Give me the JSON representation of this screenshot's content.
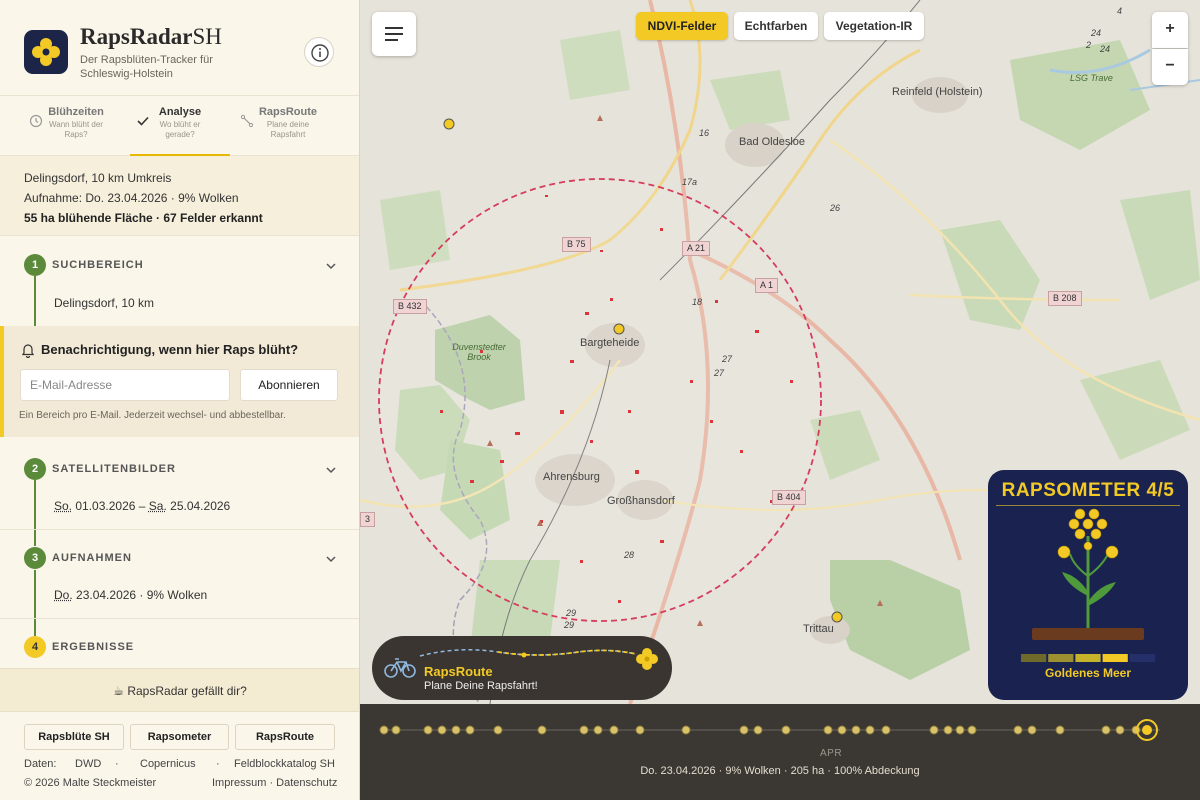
{
  "app": {
    "title_bold": "RapsRadar",
    "title_light": "SH",
    "subtitle": "Der Rapsblüten-Tracker für Schleswig-Holstein"
  },
  "tabs": [
    {
      "label": "Blühzeiten",
      "sub": "Wann blüht der Raps?",
      "icon": "clock-icon",
      "active": false
    },
    {
      "label": "Analyse",
      "sub": "Wo blüht er gerade?",
      "icon": "check-icon",
      "active": true
    },
    {
      "label": "RapsRoute",
      "sub": "Plane deine Rapsfahrt",
      "icon": "route-icon",
      "active": false
    }
  ],
  "summary": {
    "line1": "Delingsdorf, 10 km Umkreis",
    "line2": "Aufnahme: Do. 23.04.2026 · 9% Wolken",
    "line3": "55 ha blühende Fläche · 67 Felder erkannt"
  },
  "steps": [
    {
      "num": "1",
      "title": "SUCHBEREICH",
      "value": "Delingsdorf, 10 km"
    },
    {
      "num": "2",
      "title": "SATELLITENBILDER",
      "value_from": "So.",
      "date_from": "01.03.2026",
      "sep": "–",
      "value_to": "Sa.",
      "date_to": "25.04.2026"
    },
    {
      "num": "3",
      "title": "AUFNAHMEN",
      "value_day": "Do.",
      "value": "23.04.2026 · 9% Wolken"
    },
    {
      "num": "4",
      "title": "ERGEBNISSE"
    }
  ],
  "notify": {
    "title": "Benachrichtigung, wenn hier Raps blüht?",
    "placeholder": "E-Mail-Adresse",
    "button": "Abonnieren",
    "note": "Ein Bereich pro E-Mail. Jederzeit wechsel- und abbestellbar."
  },
  "like": "☕  RapsRadar gefällt dir?",
  "footer": {
    "buttons": [
      "Rapsblüte SH",
      "Rapsometer",
      "RapsRoute"
    ],
    "data_label": "Daten:",
    "sources": [
      "DWD",
      "·",
      "Copernicus",
      "·",
      "Feldblockkatalog SH"
    ],
    "copyright": "© 2026 Malte Steckmeister",
    "links": "Impressum · Datenschutz"
  },
  "map": {
    "layers": [
      {
        "label": "NDVI-Felder",
        "active": true
      },
      {
        "label": "Echtfarben",
        "active": false
      },
      {
        "label": "Vegetation-IR",
        "active": false
      }
    ],
    "zoom_in": "+",
    "zoom_out": "−",
    "places": [
      "Reinfeld (Holstein)",
      "Bad Oldesloe",
      "Bargteheide",
      "Ahrensburg",
      "Großhansdorf",
      "Trittau",
      "Duvenstedter Brook",
      "LSG Trave"
    ],
    "roads": [
      "B 75",
      "A 21",
      "A 1",
      "B 432",
      "B 208",
      "B 404",
      "3"
    ],
    "road_numbers": [
      "16",
      "17a",
      "26",
      "18",
      "27",
      "27",
      "28",
      "29",
      "29",
      "24",
      "24",
      "2",
      "4"
    ]
  },
  "route_card": {
    "title": "RapsRoute",
    "subtitle": "Plane Deine Rapsfahrt!"
  },
  "rapsometer": {
    "title": "RAPSOMETER 4/5",
    "level": 4,
    "max": 5,
    "caption": "Goldenes Meer"
  },
  "timeline": {
    "month": "APR",
    "info": "Do. 23.04.2026 · 9% Wolken · 205 ha · 100% Abdeckung"
  },
  "colors": {
    "accent": "#f2c925",
    "green": "#5a8a3a",
    "navy": "#1a2350",
    "field_red": "#d9353a"
  }
}
